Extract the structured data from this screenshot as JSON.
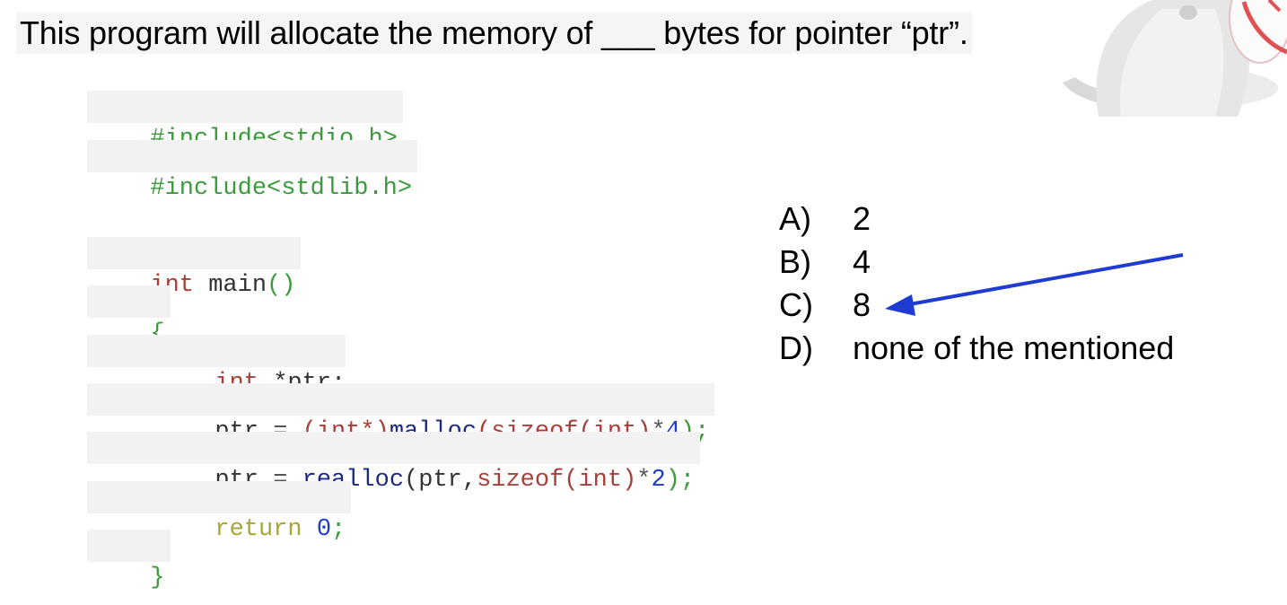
{
  "question": "This program will allocate the memory of ___ bytes for pointer “ptr”.",
  "code": {
    "include1": {
      "directive": "#include",
      "header": "<stdio.h>"
    },
    "include2": {
      "directive": "#include",
      "header": "<stdlib.h>"
    },
    "main": {
      "type": "int",
      "name": "main",
      "parens": "()"
    },
    "open_brace": "{",
    "decl": {
      "type": "int",
      "var": " *ptr;"
    },
    "line_malloc": {
      "var": "ptr",
      "eq": " = ",
      "cast": "(int*)",
      "fn": "malloc",
      "arg_open": "(sizeof(int)",
      "mult": "*",
      "num": "4",
      "close": ");"
    },
    "line_realloc": {
      "var": "ptr",
      "eq": " = ",
      "fn": "realloc",
      "arg_open": "(ptr,",
      "sizeof": "sizeof(int)",
      "mult": "*",
      "num": "2",
      "close": ");"
    },
    "line_return": {
      "kw": "return",
      "num": " 0",
      "semi": ";"
    },
    "close_brace": "}"
  },
  "options": [
    {
      "letter": "A)",
      "text": "2"
    },
    {
      "letter": "B)",
      "text": "4"
    },
    {
      "letter": "C)",
      "text": "8"
    },
    {
      "letter": "D)",
      "text": "none of the mentioned"
    }
  ],
  "colors": {
    "arrow": "#1e3bd2",
    "include": "#3c9a3c",
    "keyword": "#a7403a",
    "function": "#1c2a86",
    "number": "#1e3bd2",
    "return": "#a8a63a"
  },
  "decor": {
    "image": "cat-mascot-icon",
    "annotation": "arrow-pointing-to-option-C"
  }
}
